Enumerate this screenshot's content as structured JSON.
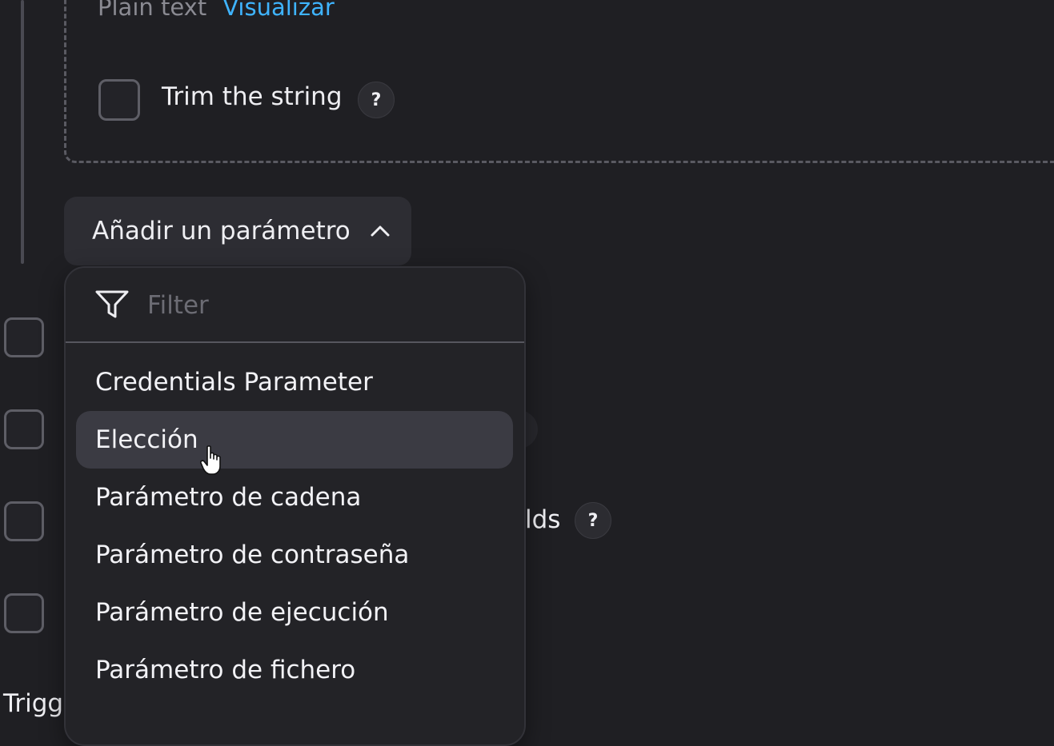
{
  "plain_text": {
    "label": "Plain text",
    "visualize_link": "Visualizar"
  },
  "trim": {
    "label": "Trim the string",
    "help": "?"
  },
  "add_parameter": {
    "label": "Añadir un parámetro",
    "icon": "chevron-up-icon"
  },
  "filter": {
    "placeholder": "Filter",
    "icon": "filter-icon"
  },
  "options": [
    {
      "label": "Credentials Parameter",
      "active": false
    },
    {
      "label": "Elección",
      "active": true
    },
    {
      "label": "Parámetro de cadena",
      "active": false
    },
    {
      "label": "Parámetro de contraseña",
      "active": false
    },
    {
      "label": "Parámetro de ejecución",
      "active": false
    },
    {
      "label": "Parámetro de fichero",
      "active": false
    }
  ],
  "background": {
    "fields_fragment": "lds",
    "fields_help": "?",
    "trigger_fragment": "Trigg"
  },
  "colors": {
    "background": "#1f1f23",
    "link": "#3fb4ff",
    "option_hover": "#3b3b43",
    "dropdown": "#232327"
  }
}
